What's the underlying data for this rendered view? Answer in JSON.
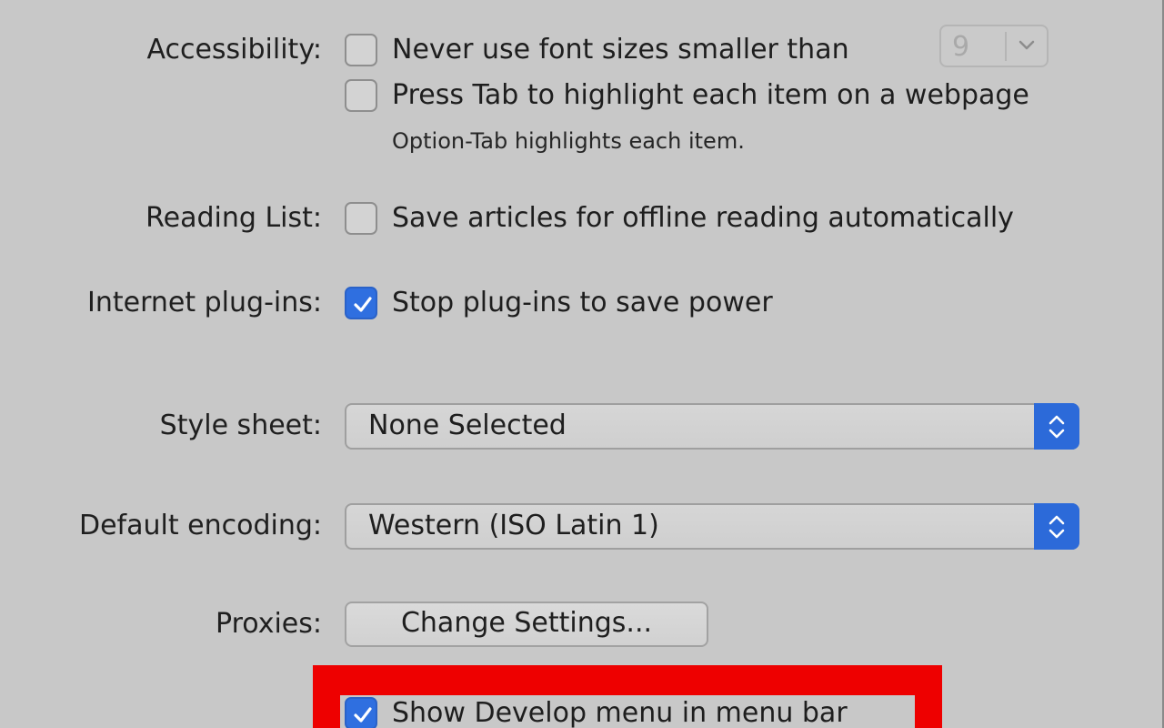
{
  "accessibility": {
    "label": "Accessibility:",
    "min_font_size": {
      "checked": false,
      "text": "Never use font sizes smaller than",
      "value": "9"
    },
    "tab_highlight": {
      "checked": false,
      "text": "Press Tab to highlight each item on a webpage",
      "hint": "Option-Tab highlights each item."
    }
  },
  "reading_list": {
    "label": "Reading List:",
    "checked": false,
    "text": "Save articles for offline reading automatically"
  },
  "plugins": {
    "label": "Internet plug-ins:",
    "checked": true,
    "text": "Stop plug-ins to save power"
  },
  "style_sheet": {
    "label": "Style sheet:",
    "value": "None Selected"
  },
  "encoding": {
    "label": "Default encoding:",
    "value": "Western (ISO Latin 1)"
  },
  "proxies": {
    "label": "Proxies:",
    "button_label": "Change Settings..."
  },
  "develop_menu": {
    "checked": true,
    "text": "Show Develop menu in menu bar"
  },
  "colors": {
    "accent": "#2f6fe0",
    "highlight": "#ee0000",
    "background": "#c8c8c8"
  }
}
